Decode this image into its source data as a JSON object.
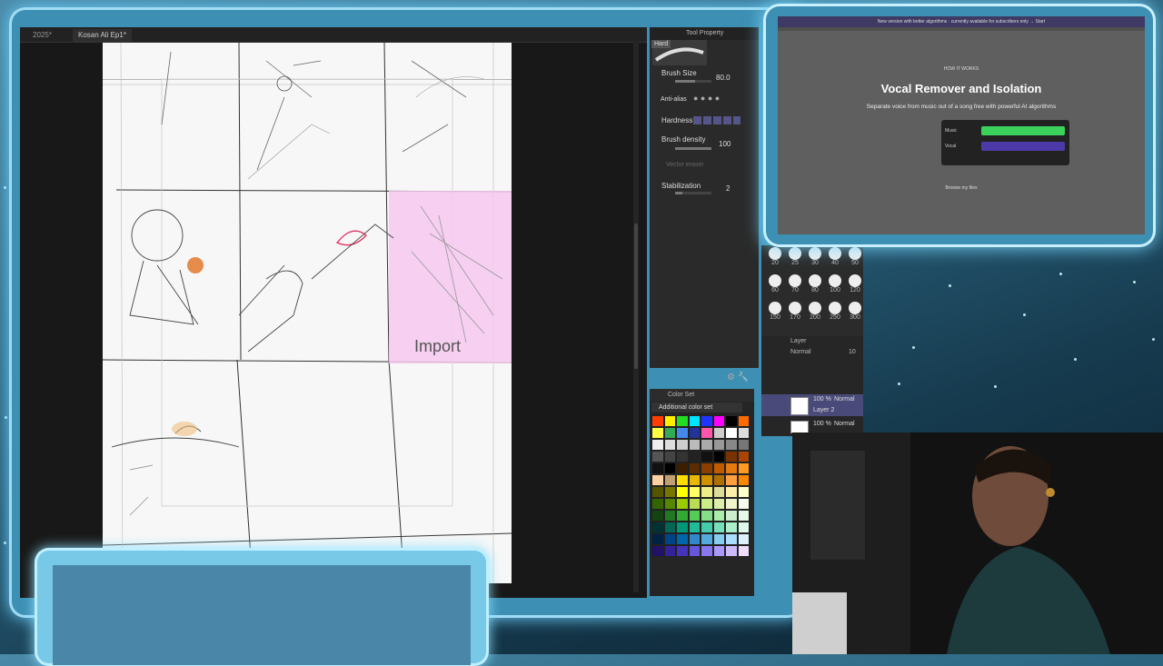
{
  "app": {
    "tabs": [
      {
        "label": "2025*"
      },
      {
        "label": "Kosan Ali Ep1*"
      }
    ],
    "canvas_text": "Import"
  },
  "tool_property": {
    "header": "Tool Property",
    "brush_tab": "Hard",
    "brush_size_label": "Brush Size",
    "brush_size_value": "80.0",
    "anti_alias_label": "Anti-alias",
    "hardness_label": "Hardness",
    "brush_density_label": "Brush density",
    "brush_density_value": "100",
    "vector_label": "Vector eraser",
    "stabilization_label": "Stabilization",
    "stabilization_value": "2"
  },
  "brush_sizes": [
    "20",
    "25",
    "30",
    "40",
    "50",
    "60",
    "70",
    "80",
    "100",
    "120",
    "150",
    "170",
    "200",
    "250",
    "300"
  ],
  "layer_panel": {
    "header": "Layer",
    "blend_mode": "Normal",
    "opacity": "10",
    "layers": [
      {
        "opacity": "100 %",
        "blend": "Normal",
        "name": "Layer 2"
      },
      {
        "opacity": "100 %",
        "blend": "Normal",
        "name": ""
      }
    ]
  },
  "color_set": {
    "header": "Color Set",
    "selected_set": "Additional color set",
    "colors": [
      "#ff3d00",
      "#ffee00",
      "#22dd22",
      "#00e5ff",
      "#2233ff",
      "#ff00ff",
      "#000000",
      "#ff6a00",
      "#ffff44",
      "#33aa55",
      "#4488ee",
      "#223399",
      "#ff55aa",
      "#cccccc",
      "#ffffff",
      "#dddddd",
      "#eeeeee",
      "#dddddd",
      "#cccccc",
      "#bbbbbb",
      "#aaaaaa",
      "#999999",
      "#888888",
      "#777777",
      "#555555",
      "#444444",
      "#333333",
      "#222222",
      "#111111",
      "#000000",
      "#7a3300",
      "#aa4400",
      "#111111",
      "#000000",
      "#3b1f00",
      "#5a2c00",
      "#8a3e00",
      "#c25a00",
      "#e57a10",
      "#ff9a20",
      "#ffd0a0",
      "#c0a070",
      "#ffdd00",
      "#e8b800",
      "#d09000",
      "#b07000",
      "#ffa040",
      "#ff8800",
      "#555500",
      "#777700",
      "#ffff00",
      "#ffff66",
      "#eeee88",
      "#dddd99",
      "#ffeeaa",
      "#ffffcc",
      "#336600",
      "#558800",
      "#99cc00",
      "#bbdd55",
      "#ccee88",
      "#ddeeaa",
      "#eef5cc",
      "#f5faee",
      "#114411",
      "#227722",
      "#33aa33",
      "#55cc55",
      "#88dd88",
      "#aaeeaa",
      "#cceecc",
      "#e8f8e8",
      "#003333",
      "#006655",
      "#009977",
      "#22bb99",
      "#44ccaa",
      "#77ddbb",
      "#aaeecc",
      "#ddf8ee",
      "#002244",
      "#004488",
      "#0066aa",
      "#3388cc",
      "#55aadd",
      "#88ccee",
      "#aaddff",
      "#ddf0ff",
      "#221166",
      "#332299",
      "#4433bb",
      "#6655dd",
      "#8877ee",
      "#aa99ff",
      "#ccbbff",
      "#eeddff"
    ]
  },
  "website": {
    "banner": "New version with better algorithms · currently available for subscribers only → Start",
    "eyebrow": "HOW IT WORKS",
    "title": "Vocal Remover and Isolation",
    "subtitle": "Separate voice from music out of a song free with powerful AI algorithms",
    "tracks": [
      {
        "label": "Music",
        "color": "#3ad25a"
      },
      {
        "label": "Vocal",
        "color": "#4d3aa8"
      }
    ],
    "footer_link": "Browse my files"
  }
}
